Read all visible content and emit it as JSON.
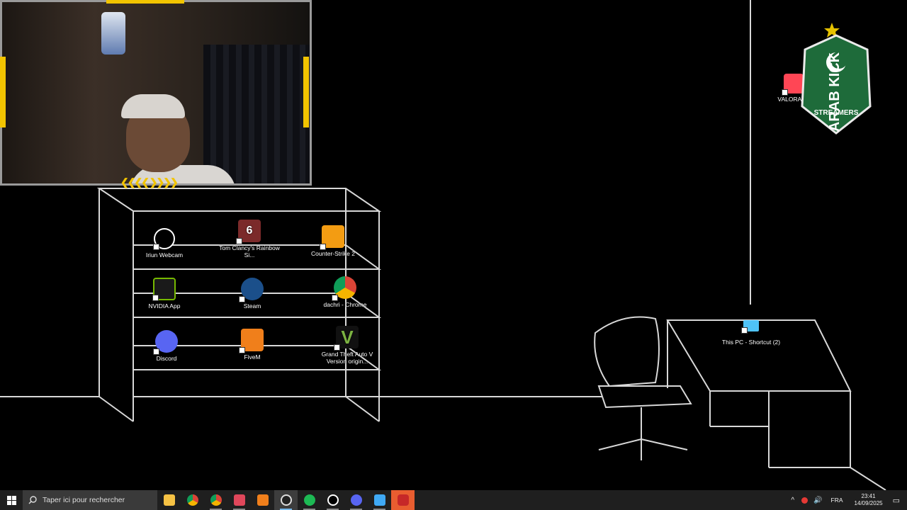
{
  "desktop": {
    "icons": [
      {
        "label": "Iriun Webcam",
        "icon": "iriun-icon",
        "color": "#ffffff"
      },
      {
        "label": "Tom Clancy's Rainbow Si...",
        "icon": "rainbow-six-icon",
        "color": "#c0392b"
      },
      {
        "label": "Counter-Strike 2",
        "icon": "counter-strike-icon",
        "color": "#f39c12"
      },
      {
        "label": "NVIDIA App",
        "icon": "nvidia-icon",
        "color": "#76b900"
      },
      {
        "label": "Steam",
        "icon": "steam-icon",
        "color": "#1b4f8a"
      },
      {
        "label": "dachri - Chrome",
        "icon": "chrome-icon",
        "color": "#db4437"
      },
      {
        "label": "Discord",
        "icon": "discord-icon",
        "color": "#5865f2"
      },
      {
        "label": "FiveM",
        "icon": "fivem-icon",
        "color": "#f07f1b"
      },
      {
        "label": "Grand Theft Auto V Version origin...",
        "icon": "gta-v-icon",
        "color": "#7cb342"
      },
      {
        "label": "This PC - Shortcut (2)",
        "icon": "this-pc-icon",
        "color": "#4fc3f7"
      },
      {
        "label": "VALORANT",
        "icon": "valorant-icon",
        "color": "#ff4655"
      }
    ],
    "six_digit": "6"
  },
  "badge": {
    "text_main": "ARAB KICK",
    "text_sub": "STREAMERS",
    "color": "#1e6b3a"
  },
  "taskbar": {
    "search_placeholder": "Taper ici pour rechercher",
    "apps": [
      {
        "name": "file-explorer-icon",
        "color": "#f6c244"
      },
      {
        "name": "chrome-icon",
        "color": "#db4437"
      },
      {
        "name": "chrome-profile-icon",
        "color": "#4caf50"
      },
      {
        "name": "brave-icon",
        "color": "#e0475b"
      },
      {
        "name": "fivem-icon",
        "color": "#f07f1b"
      },
      {
        "name": "obs-icon",
        "color": "#2b2b2b"
      },
      {
        "name": "spotify-icon",
        "color": "#1db954"
      },
      {
        "name": "iriun-icon",
        "color": "#ffffff"
      },
      {
        "name": "discord-icon",
        "color": "#5865f2"
      },
      {
        "name": "paint-icon",
        "color": "#3fa9f5"
      },
      {
        "name": "record-icon",
        "color": "#e53935"
      }
    ],
    "language": "FRA",
    "time": "23:41",
    "date": "14/09/2025"
  }
}
